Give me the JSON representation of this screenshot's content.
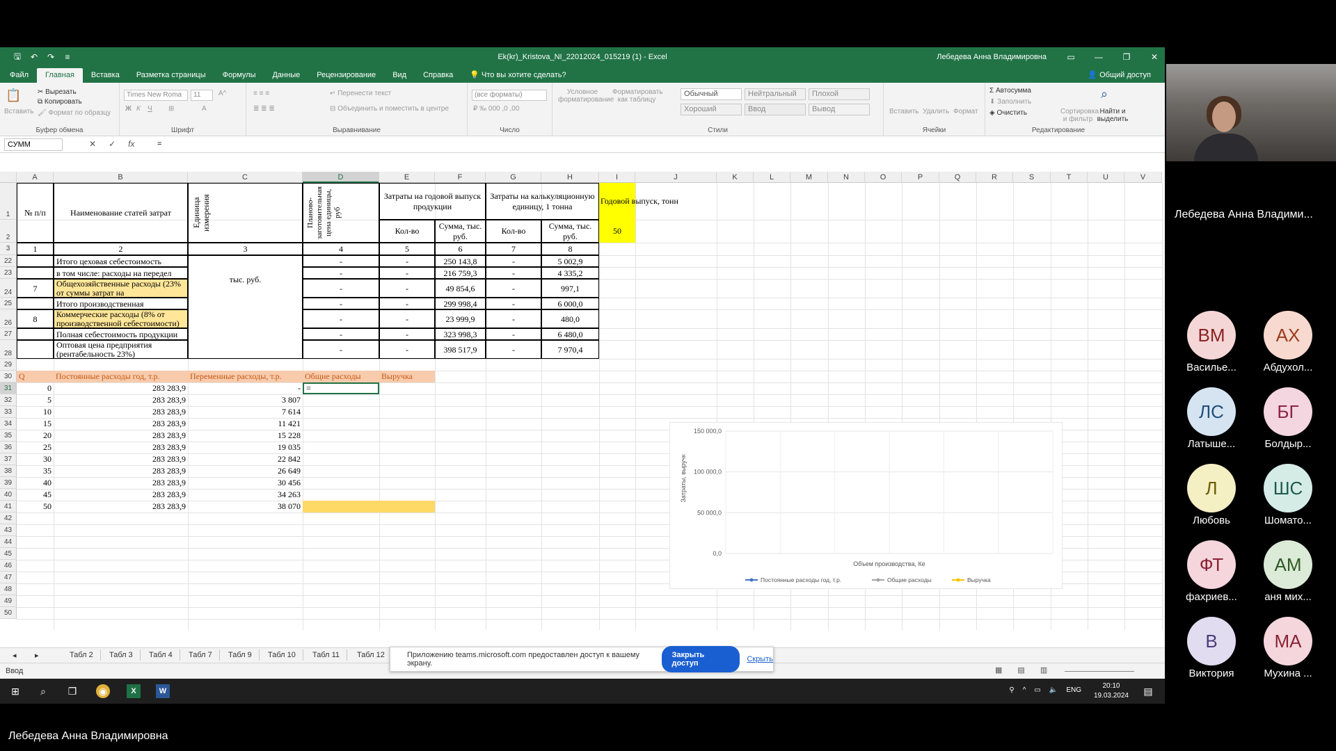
{
  "window": {
    "title": "Ek(kr)_Kristova_NI_22012024_015219 (1)  -  Excel",
    "user": "Лебедева Анна Владимировна",
    "share_label": "Общий доступ"
  },
  "ribbon_tabs": [
    "Файл",
    "Главная",
    "Вставка",
    "Разметка страницы",
    "Формулы",
    "Данные",
    "Рецензирование",
    "Вид",
    "Справка",
    "Что вы хотите сделать?"
  ],
  "ribbon": {
    "clipboard": {
      "paste": "Вставить",
      "cut": "Вырезать",
      "copy": "Копировать",
      "format_painter": "Формат по образцу",
      "label": "Буфер обмена"
    },
    "font": {
      "family": "Times New Roma",
      "size": "11",
      "label": "Шрифт"
    },
    "alignment": {
      "wrap": "Перенести текст",
      "merge": "Объединить и поместить в центре",
      "label": "Выравнивание"
    },
    "number": {
      "format": "(все форматы)",
      "label": "Число"
    },
    "styles": {
      "cond_format": "Условное форматирование",
      "as_table": "Форматировать как таблицу",
      "normal": "Обычный",
      "neutral": "Нейтральный",
      "bad": "Плохой",
      "good": "Хороший",
      "input": "Ввод",
      "output": "Вывод",
      "label": "Стили"
    },
    "cells": {
      "insert": "Вставить",
      "delete": "Удалить",
      "format": "Формат",
      "label": "Ячейки"
    },
    "editing": {
      "autosum": "Автосумма",
      "fill": "Заполнить",
      "clear": "Очистить",
      "sort": "Сортировка и фильтр",
      "find": "Найти и выделить",
      "label": "Редактирование"
    }
  },
  "formula_bar": {
    "name_box": "СУММ",
    "formula": "="
  },
  "columns": [
    "A",
    "B",
    "C",
    "D",
    "E",
    "F",
    "G",
    "H",
    "I",
    "J",
    "K",
    "L",
    "M",
    "N",
    "O",
    "P",
    "Q",
    "R",
    "S",
    "T",
    "U",
    "V"
  ],
  "rows": [
    "1",
    "2",
    "3",
    "22",
    "23",
    "24",
    "25",
    "26",
    "27",
    "28",
    "29",
    "30",
    "31",
    "32",
    "33",
    "34",
    "35",
    "36",
    "37",
    "38",
    "39",
    "40",
    "41",
    "42",
    "43",
    "44",
    "45",
    "46",
    "47",
    "48",
    "49",
    "50"
  ],
  "table": {
    "h_num": "№ п/п",
    "h_name": "Наименование статей затрат",
    "h_unit": "Единица измерения",
    "h_price": "Планово-заготовительная цена единицы, руб",
    "h_annual": "Затраты на годовой выпуск продукции",
    "h_unitcost": "Затраты на калькуляционную единицу, 1 тонна",
    "h_qty": "Кол-во",
    "h_sum": "Сумма, тыс. руб.",
    "h_qty2": "Кол-во",
    "h_sum2": "Сумма, тыс. руб.",
    "h_output": "Годовой выпуск, тонн",
    "output_value": "50",
    "idx": [
      "1",
      "2",
      "3",
      "4",
      "5",
      "6",
      "7",
      "8"
    ],
    "unit_label": "тыс. руб.",
    "rows": [
      {
        "num": "",
        "name": "Итого цеховая себестоимость",
        "d": "-",
        "e": "-",
        "f": "250 143,8",
        "g": "-",
        "h": "5 002,9"
      },
      {
        "num": "",
        "name": "в том числе: расходы на передел",
        "d": "-",
        "e": "-",
        "f": "216 759,3",
        "g": "-",
        "h": "4 335,2"
      },
      {
        "num": "7",
        "name": "Общехозяйственные расходы (23% от суммы затрат на",
        "d": "-",
        "e": "-",
        "f": "49 854,6",
        "g": "-",
        "h": "997,1"
      },
      {
        "num": "",
        "name": "Итого производственная",
        "d": "-",
        "e": "-",
        "f": "299 998,4",
        "g": "-",
        "h": "6 000,0"
      },
      {
        "num": "8",
        "name": "Коммерческие расходы (8% от производственной себестоимости)",
        "d": "-",
        "e": "-",
        "f": "23 999,9",
        "g": "-",
        "h": "480,0"
      },
      {
        "num": "",
        "name": "Полная себестоимость продукции",
        "d": "-",
        "e": "-",
        "f": "323 998,3",
        "g": "-",
        "h": "6 480,0"
      },
      {
        "num": "",
        "name": "Оптовая цена предприятия (рентабельность 23%)",
        "d": "-",
        "e": "-",
        "f": "398 517,9",
        "g": "-",
        "h": "7 970,4"
      }
    ]
  },
  "breakeven": {
    "h_q": "Q",
    "h_fixed": "Постоянные расходы год, т.р.",
    "h_var": "Переменные расходы, т.р.",
    "h_total": "Общие расходы",
    "h_revenue": "Выручка",
    "editing_value": "=",
    "rows": [
      {
        "q": "0",
        "fixed": "283 283,9",
        "var": "-"
      },
      {
        "q": "5",
        "fixed": "283 283,9",
        "var": "3 807"
      },
      {
        "q": "10",
        "fixed": "283 283,9",
        "var": "7 614"
      },
      {
        "q": "15",
        "fixed": "283 283,9",
        "var": "11 421"
      },
      {
        "q": "20",
        "fixed": "283 283,9",
        "var": "15 228"
      },
      {
        "q": "25",
        "fixed": "283 283,9",
        "var": "19 035"
      },
      {
        "q": "30",
        "fixed": "283 283,9",
        "var": "22 842"
      },
      {
        "q": "35",
        "fixed": "283 283,9",
        "var": "26 649"
      },
      {
        "q": "40",
        "fixed": "283 283,9",
        "var": "30 456"
      },
      {
        "q": "45",
        "fixed": "283 283,9",
        "var": "34 263"
      },
      {
        "q": "50",
        "fixed": "283 283,9",
        "var": "38 070"
      }
    ]
  },
  "chart": {
    "ylabel": "Затраты, выручк",
    "xlabel": "Объем производства, Ке",
    "yticks": [
      "150 000,0",
      "100 000,0",
      "50 000,0",
      "0,0"
    ],
    "legend": [
      "Постоянные расходы год, т.р.",
      "Общие расходы",
      "Выручка"
    ],
    "colors": [
      "#4472c4",
      "#a5a5a5",
      "#ffc000"
    ]
  },
  "sheet_tabs": [
    "Табл 2",
    "Табл 3",
    "Табл 4",
    "Табл 7",
    "Табл 9",
    "Табл 10",
    "Табл 11",
    "Табл 12"
  ],
  "status": {
    "mode": "Ввод"
  },
  "share_note": {
    "text": "Приложению teams.microsoft.com предоставлен доступ к вашему экрану.",
    "stop": "Закрыть доступ",
    "hide": "Скрыть"
  },
  "taskbar": {
    "lang": "ENG",
    "time": "20:10",
    "date": "19.03.2024"
  },
  "participants": {
    "presenter": "Лебедева Анна Владими...",
    "people": [
      {
        "initials": "ВМ",
        "name": "Василье...",
        "bg": "#f4d6d6",
        "fg": "#8b2323"
      },
      {
        "initials": "АХ",
        "name": "Абдухол...",
        "bg": "#f7d9cf",
        "fg": "#9a3b1a"
      },
      {
        "initials": "ЛС",
        "name": "Латыше...",
        "bg": "#d6e4f2",
        "fg": "#1f4e79"
      },
      {
        "initials": "БГ",
        "name": "Болдыр...",
        "bg": "#f4d6e0",
        "fg": "#8b2346"
      },
      {
        "initials": "Л",
        "name": "Любовь",
        "bg": "#f5efc4",
        "fg": "#6b5a00"
      },
      {
        "initials": "ШС",
        "name": "Шомато...",
        "bg": "#d5ece6",
        "fg": "#1e5b4f"
      },
      {
        "initials": "ФТ",
        "name": "фахриев...",
        "bg": "#f4d6dc",
        "fg": "#8b2335"
      },
      {
        "initials": "АМ",
        "name": "аня мих...",
        "bg": "#dcead8",
        "fg": "#2f5a26"
      },
      {
        "initials": "В",
        "name": "Виктория",
        "bg": "#e2dcf0",
        "fg": "#4a3b7a"
      },
      {
        "initials": "МА",
        "name": "Мухина ...",
        "bg": "#f4d6dc",
        "fg": "#8b2335"
      }
    ]
  },
  "bottom_name": "Лебедева Анна Владимировна"
}
